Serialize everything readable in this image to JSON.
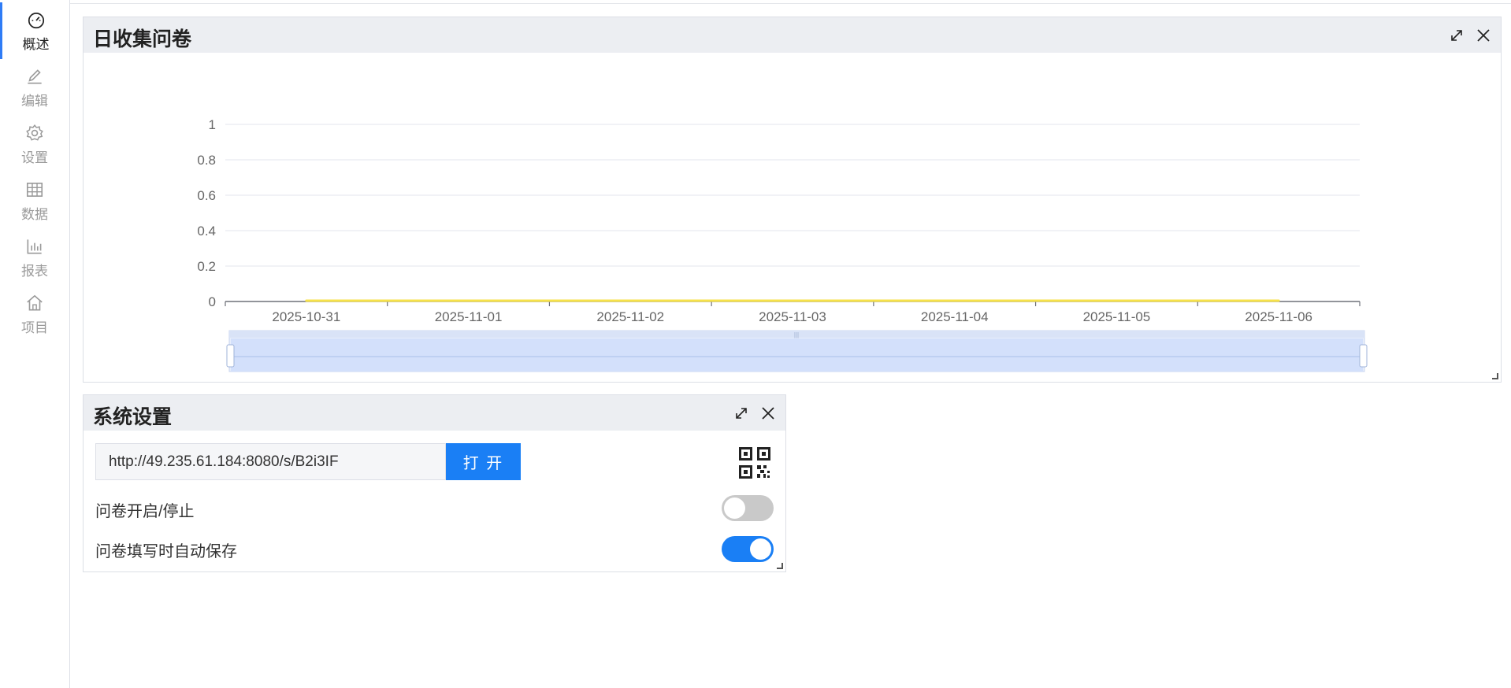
{
  "sidebar": {
    "items": [
      {
        "label": "概述",
        "icon": "dashboard-icon",
        "active": true
      },
      {
        "label": "编辑",
        "icon": "pencil-icon",
        "active": false
      },
      {
        "label": "设置",
        "icon": "gear-icon",
        "active": false
      },
      {
        "label": "数据",
        "icon": "table-icon",
        "active": false
      },
      {
        "label": "报表",
        "icon": "bar-chart-icon",
        "active": false
      },
      {
        "label": "项目",
        "icon": "home-icon",
        "active": false
      }
    ]
  },
  "chart_panel": {
    "title": "日收集问卷",
    "expand_icon": "expand-icon",
    "close_icon": "close-icon"
  },
  "chart_data": {
    "type": "line",
    "title": "",
    "x": [
      "2025-10-31",
      "2025-11-01",
      "2025-11-02",
      "2025-11-03",
      "2025-11-04",
      "2025-11-05",
      "2025-11-06"
    ],
    "series": [
      {
        "values": [
          0,
          0,
          0,
          0,
          0,
          0,
          0
        ],
        "color": "#f7e24a"
      }
    ],
    "y_ticks": [
      "0",
      "0.2",
      "0.4",
      "0.6",
      "0.8",
      "1"
    ],
    "ylim": [
      0,
      1
    ],
    "grid": true,
    "data_zoom": {
      "start": 0,
      "end": 100
    }
  },
  "settings_panel": {
    "title": "系统设置",
    "url": "http://49.235.61.184:8080/s/B2i3IF",
    "open_button": "打 开",
    "qr_icon": "qr-code-icon",
    "settings": [
      {
        "label": "问卷开启/停止",
        "on": false
      },
      {
        "label": "问卷填写时自动保存",
        "on": true
      }
    ]
  },
  "colors": {
    "accent": "#1a7ff5",
    "header_bg": "#eceef2",
    "toggle_off": "#c9c9c9"
  }
}
